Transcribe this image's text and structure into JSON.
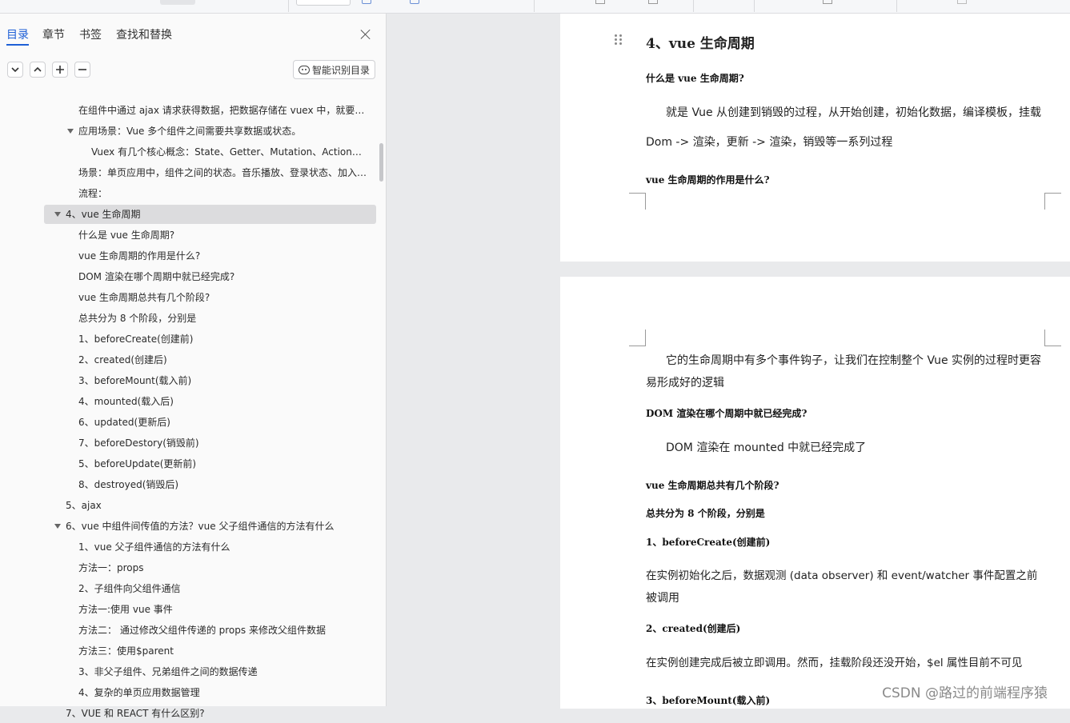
{
  "sidebar": {
    "tabs": [
      "目录",
      "章节",
      "书签",
      "查找和替换"
    ],
    "smart_button": "智能识别目录",
    "toc": [
      {
        "text": "在组件中通过 ajax 请求获得数据，把数据存储在 vuex 中，就要先存储在 vuex 的 state 中",
        "level": 3,
        "caret": false
      },
      {
        "text": "应用场景：Vue 多个组件之间需要共享数据或状态。",
        "level": 2,
        "caret": true
      },
      {
        "text": "Vuex 有几个核心概念：State、Getter、Mutation、Action、Module",
        "level": 4,
        "caret": false
      },
      {
        "text": "场景：单页应用中，组件之间的状态。音乐播放、登录状态、加入购物车",
        "level": 3,
        "caret": false
      },
      {
        "text": "流程：",
        "level": 3,
        "caret": false
      },
      {
        "text": "4、vue 生命周期",
        "level": 1,
        "caret": true,
        "selected": true
      },
      {
        "text": "什么是 vue 生命周期?",
        "level": 3,
        "caret": false
      },
      {
        "text": "vue 生命周期的作用是什么?",
        "level": 3,
        "caret": false
      },
      {
        "text": "DOM 渲染在哪个周期中就已经完成?",
        "level": 3,
        "caret": false
      },
      {
        "text": "vue 生命周期总共有几个阶段?",
        "level": 3,
        "caret": false
      },
      {
        "text": "总共分为 8 个阶段，分别是",
        "level": 3,
        "caret": false
      },
      {
        "text": "1、beforeCreate(创建前)",
        "level": 3,
        "caret": false
      },
      {
        "text": "2、created(创建后)",
        "level": 3,
        "caret": false
      },
      {
        "text": "3、beforeMount(载入前)",
        "level": 3,
        "caret": false
      },
      {
        "text": "4、mounted(载入后)",
        "level": 3,
        "caret": false
      },
      {
        "text": "6、updated(更新后)",
        "level": 3,
        "caret": false
      },
      {
        "text": "7、beforeDestory(销毁前)",
        "level": 3,
        "caret": false
      },
      {
        "text": "5、beforeUpdate(更新前)",
        "level": 3,
        "caret": false
      },
      {
        "text": "8、destroyed(销毁后)",
        "level": 3,
        "caret": false
      },
      {
        "text": "5、ajax",
        "level": 1,
        "caret": false
      },
      {
        "text": "6、vue 中组件间传值的方法？vue 父子组件通信的方法有什么",
        "level": 1,
        "caret": true
      },
      {
        "text": "1、vue 父子组件通信的方法有什么",
        "level": 3,
        "caret": false
      },
      {
        "text": "方法一：props",
        "level": 3,
        "caret": false
      },
      {
        "text": "2、子组件向父组件通信",
        "level": 3,
        "caret": false
      },
      {
        "text": "方法一:使用 vue 事件",
        "level": 3,
        "caret": false
      },
      {
        "text": "方法二：  通过修改父组件传递的 props 来修改父组件数据",
        "level": 3,
        "caret": false
      },
      {
        "text": "方法三：使用$parent",
        "level": 3,
        "caret": false
      },
      {
        "text": "3、非父子组件、兄弟组件之间的数据传递",
        "level": 3,
        "caret": false
      },
      {
        "text": "4、复杂的单页应用数据管理",
        "level": 3,
        "caret": false
      },
      {
        "text": "7、VUE 和 REACT 有什么区别?",
        "level": 1,
        "caret": false
      }
    ]
  },
  "doc": {
    "heading": "4、vue 生命周期",
    "q1": "什么是 vue 生命周期?",
    "p1a": "就是 Vue 从创建到销毁的过程，从开始创建，初始化数据，编译模板，挂载",
    "p1b": "Dom -> 渲染，更新 -> 渲染，销毁等一系列过程",
    "q2": "vue 生命周期的作用是什么?",
    "p2a": "它的生命周期中有多个事件钩子，让我们在控制整个 Vue 实例的过程时更容",
    "p2b": "易形成好的逻辑",
    "q3": "DOM 渲染在哪个周期中就已经完成?",
    "p3": "DOM 渲染在 mounted 中就已经完成了",
    "q4": "vue 生命周期总共有几个阶段?",
    "q5": "总共分为 8 个阶段，分别是",
    "s1": "1、beforeCreate(创建前)",
    "p4a": "在实例初始化之后，数据观测 (data observer) 和 event/watcher 事件配置之前",
    "p4b": "被调用",
    "s2": "2、created(创建后)",
    "p5": "在实例创建完成后被立即调用。然而，挂载阶段还没开始，$el 属性目前不可见",
    "s3": "3、beforeMount(载入前)"
  },
  "watermark": "CSDN @路过的前端程序猿"
}
